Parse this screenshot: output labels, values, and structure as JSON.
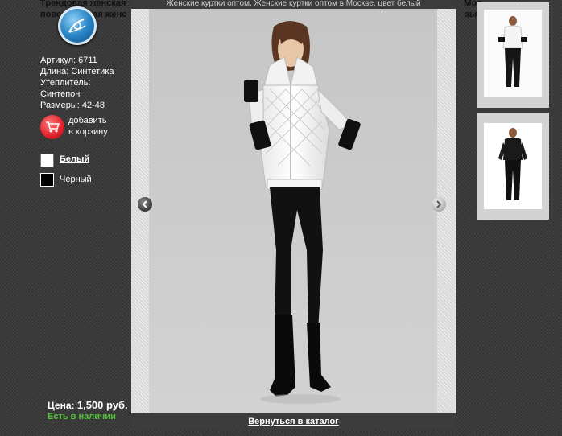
{
  "background_page": {
    "desc_line1": "Трендовая женская",
    "desc_line1_right": "Мод",
    "desc_line2": "повседневная женс",
    "desc_line2_right": "зыв",
    "specs": {
      "article": "Артикул: 6711",
      "length": "Длина: Синтетика",
      "insulation_label": "Утеплитель:",
      "insulation_value": "Синтепон",
      "sizes": "Размеры: 42-48"
    },
    "cart": {
      "line1": "добавить",
      "line2": "в корзину"
    },
    "colors": [
      {
        "name": "Белый",
        "hex": "#ffffff",
        "selected": true
      },
      {
        "name": "Черный",
        "hex": "#000000",
        "selected": false
      }
    ],
    "price_label": "Цена:",
    "price_value": "1,500 руб.",
    "stock": "Есть в наличии"
  },
  "lightbox": {
    "title": "Женские куртки оптом. Женские куртки оптом в Москве, цвет белый",
    "back_link": "Вернуться в каталог",
    "prev_icon": "chevron-left-icon",
    "next_icon": "chevron-right-icon"
  },
  "thumbnails": [
    {
      "alt": "white-jacket-thumbnail"
    },
    {
      "alt": "black-jacket-thumbnail"
    }
  ],
  "colors": {
    "accent_green": "#55c43a",
    "cart_red": "#e0202a",
    "overlay_dark": "#3b3b3b"
  }
}
